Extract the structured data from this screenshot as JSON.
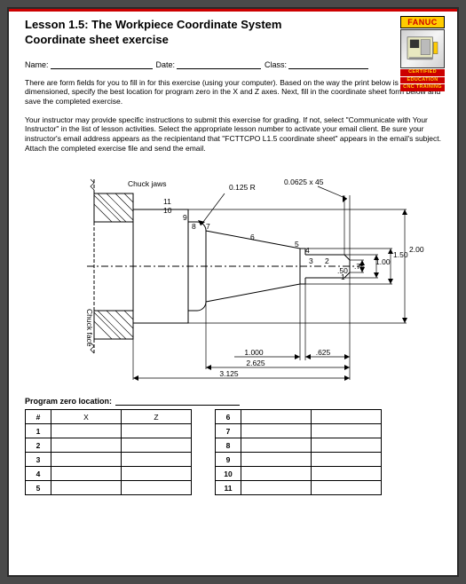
{
  "header": {
    "title_line1": "Lesson 1.5: The Workpiece Coordinate System",
    "title_line2": "Coordinate sheet exercise",
    "name_label": "Name:",
    "date_label": "Date:",
    "class_label": "Class:"
  },
  "logo": {
    "brand": "FANUC",
    "cert1": "CERTIFIED",
    "cert2": "EDUCATION",
    "cert3": "CNC TRAINING"
  },
  "paragraphs": {
    "p1": "There are form fields for you to fill in for this exercise (using your computer). Based on the way the print below is dimensioned, specify the best location for program zero in the X and Z axes. Next, fill in the coordinate sheet form below and save the completed exercise.",
    "p2": "Your instructor may provide specific instructions to submit this exercise for grading. If not, select \"Communicate with Your Instructor\" in the list of lesson activities. Select the appropriate lesson number to activate your email client. Be sure your instructor's email address appears as the recipientand that \"FCTTCPO L1.5 coordinate sheet\" appears in the email's subject. Attach the completed exercise file and send the email."
  },
  "drawing": {
    "labels": {
      "chuck_jaws": "Chuck jaws",
      "chuck_face": "Chuck face",
      "radius": "0.125 R",
      "chamfer": "0.0625 x 45",
      "d2_00": "2.00",
      "d1_50": "1.50",
      "d1_00": "1.00",
      "d0_75": ".75",
      "d0_50": ".50",
      "l1_000": "1.000",
      "l0_625": ".625",
      "l2_625": "2.625",
      "l3_125": "3.125",
      "pt5": "5",
      "pt6": "6",
      "pt7": "7",
      "pt8": "8",
      "pt9": "9",
      "pt10": "10",
      "pt11": "11",
      "pt1": "1",
      "pt2": "2",
      "pt3": "3",
      "pt4": "4"
    }
  },
  "program_zero_label": "Program zero location:",
  "table_headers": {
    "num": "#",
    "x": "X",
    "z": "Z"
  },
  "table_left_rows": [
    "1",
    "2",
    "3",
    "4",
    "5"
  ],
  "table_right_rows": [
    "6",
    "7",
    "8",
    "9",
    "10",
    "11"
  ]
}
